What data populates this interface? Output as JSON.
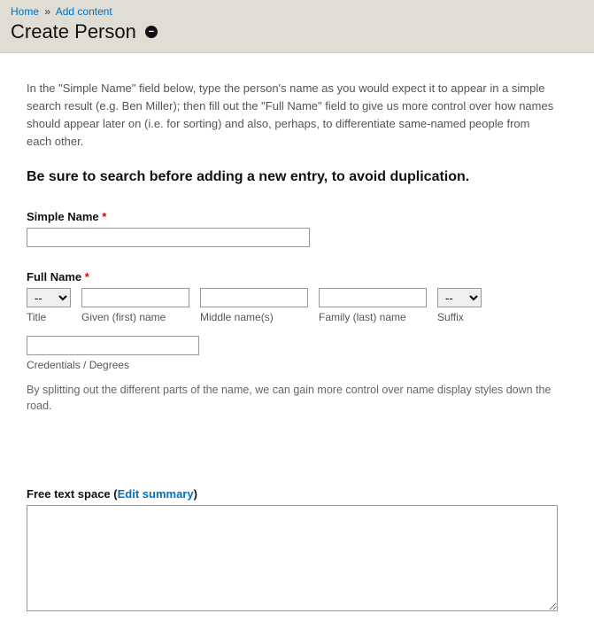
{
  "breadcrumb": {
    "home": "Home",
    "sep": "»",
    "addContent": "Add content"
  },
  "pageTitle": "Create Person",
  "intro": "In the \"Simple Name\" field below, type the person's name as you would expect it to appear in a simple search result (e.g. Ben Miller); then fill out the \"Full Name\" field to give us more control over how names should appear later on (i.e. for sorting) and also, perhaps, to differentiate same-named people from each other.",
  "warning": "Be sure to search before adding a new entry, to avoid duplication.",
  "simpleName": {
    "label": "Simple Name",
    "value": ""
  },
  "fullName": {
    "label": "Full Name",
    "title": {
      "label": "Title",
      "selected": "--"
    },
    "given": {
      "label": "Given (first) name",
      "value": ""
    },
    "middle": {
      "label": "Middle name(s)",
      "value": ""
    },
    "family": {
      "label": "Family (last) name",
      "value": ""
    },
    "suffix": {
      "label": "Suffix",
      "selected": "--"
    },
    "credentials": {
      "label": "Credentials / Degrees",
      "value": ""
    },
    "help": "By splitting out the different parts of the name, we can gain more control over name display styles down the road."
  },
  "freeText": {
    "label": "Free text space",
    "editSummary": "Edit summary",
    "value": ""
  },
  "requiredMark": "*"
}
